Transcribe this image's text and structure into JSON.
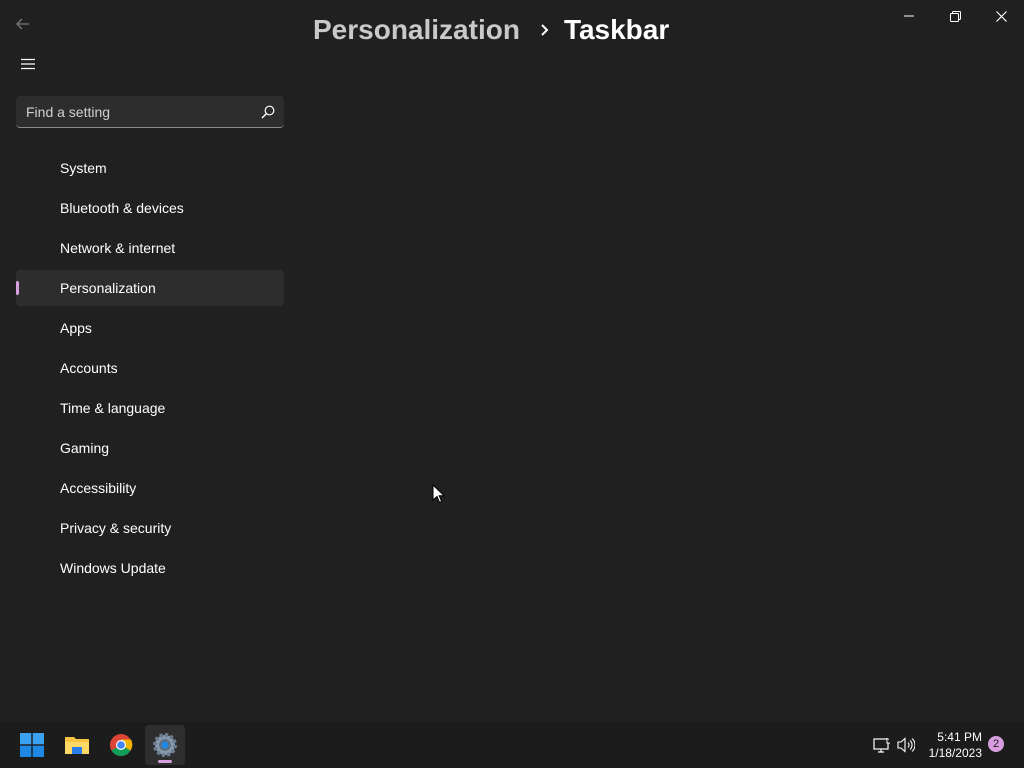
{
  "window": {
    "breadcrumb": {
      "parent": "Personalization",
      "current": "Taskbar"
    }
  },
  "search": {
    "placeholder": "Find a setting"
  },
  "nav": {
    "items": [
      {
        "label": "System"
      },
      {
        "label": "Bluetooth & devices"
      },
      {
        "label": "Network & internet"
      },
      {
        "label": "Personalization",
        "selected": true
      },
      {
        "label": "Apps"
      },
      {
        "label": "Accounts"
      },
      {
        "label": "Time & language"
      },
      {
        "label": "Gaming"
      },
      {
        "label": "Accessibility"
      },
      {
        "label": "Privacy & security"
      },
      {
        "label": "Windows Update"
      }
    ]
  },
  "taskbar": {
    "apps": [
      "start-icon",
      "file-explorer-icon",
      "chrome-icon",
      "settings-icon"
    ],
    "active_app": "settings-icon",
    "tray_icons": [
      "network-icon",
      "volume-icon"
    ],
    "time": "5:41 PM",
    "date": "1/18/2023",
    "notification_count": "2"
  },
  "colors": {
    "background": "#202020",
    "accent": "#d89ee0",
    "selected_item": "#2d2d2d",
    "taskbar": "#1c1c1c"
  }
}
